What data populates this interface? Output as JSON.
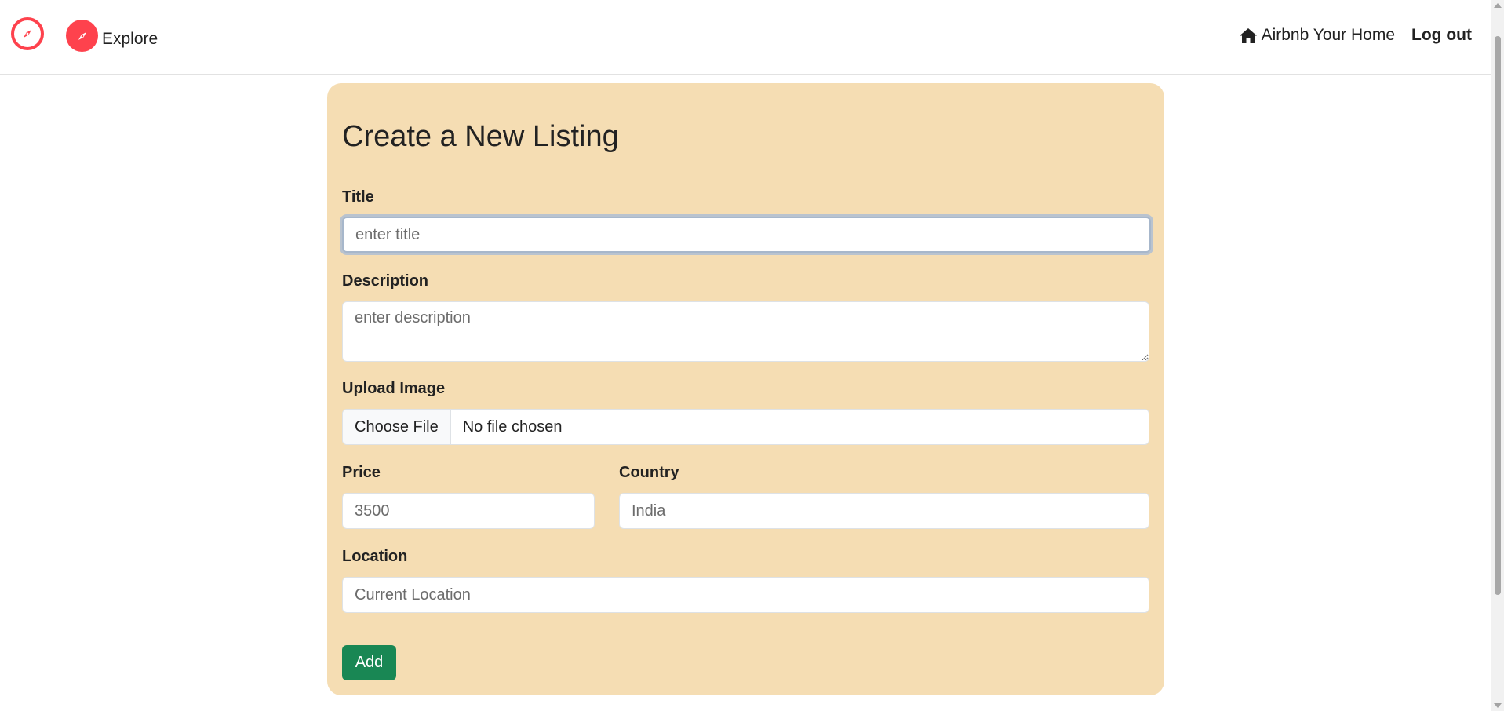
{
  "navbar": {
    "brand_icon": "compass-icon",
    "explore_label": "Explore",
    "home_label": "Airbnb Your Home",
    "logout_label": "Log out"
  },
  "colors": {
    "brand": "#fe424d",
    "card_background": "#f5ddb3",
    "add_button": "#198754"
  },
  "form": {
    "title": "Create a New Listing",
    "title_field": {
      "label": "Title",
      "placeholder": "enter title"
    },
    "description_field": {
      "label": "Description",
      "placeholder": "enter description"
    },
    "image_field": {
      "label": "Upload Image",
      "button_label": "Choose File",
      "status": "No file chosen"
    },
    "price_field": {
      "label": "Price",
      "placeholder": "3500"
    },
    "country_field": {
      "label": "Country",
      "placeholder": "India"
    },
    "location_field": {
      "label": "Location",
      "placeholder": "Current Location"
    },
    "submit_label": "Add"
  }
}
